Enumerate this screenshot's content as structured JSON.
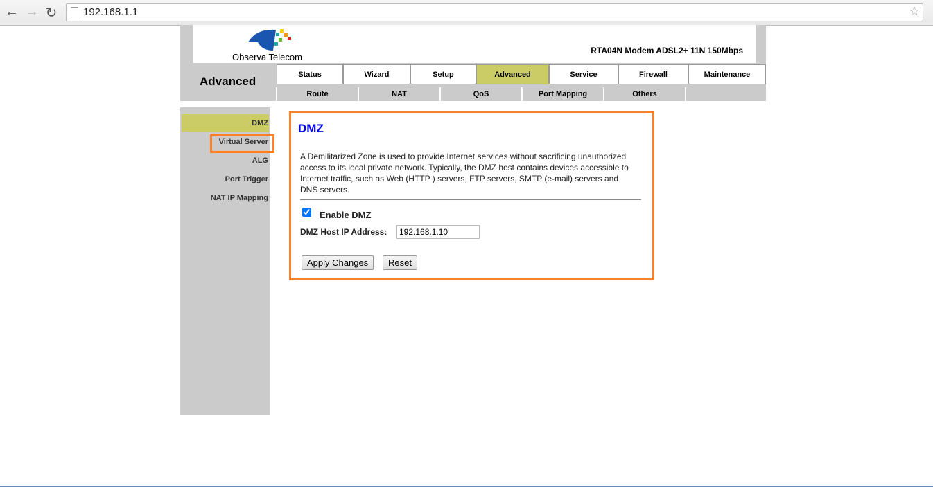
{
  "browser": {
    "url": "192.168.1.1"
  },
  "header": {
    "brand": "Observa Telecom",
    "model": "RTA04N Modem ADSL2+ 11N 150Mbps",
    "section": "Advanced",
    "tabs": [
      "Status",
      "Wizard",
      "Setup",
      "Advanced",
      "Service",
      "Firewall",
      "Maintenance"
    ],
    "active_tab": "Advanced",
    "subtabs": [
      "Route",
      "NAT",
      "QoS",
      "Port Mapping",
      "Others",
      ""
    ]
  },
  "sidebar": {
    "items": [
      "DMZ",
      "Virtual Server",
      "ALG",
      "Port Trigger",
      "NAT IP Mapping"
    ],
    "active": "DMZ",
    "highlighted": "Virtual Server"
  },
  "main": {
    "title": "DMZ",
    "description": "A Demilitarized Zone is used to provide Internet services without sacrificing unauthorized access to its local private network. Typically, the DMZ host contains devices accessible to Internet traffic, such as Web (HTTP ) servers, FTP servers, SMTP (e-mail) servers and DNS servers.",
    "enable_label": "Enable DMZ",
    "enable_checked": true,
    "host_label": "DMZ Host IP Address:",
    "host_value": "192.168.1.10",
    "apply_label": "Apply Changes",
    "reset_label": "Reset"
  },
  "colors": {
    "accent": "#cccc66",
    "highlight": "#ff8024",
    "title": "#0000ee"
  }
}
